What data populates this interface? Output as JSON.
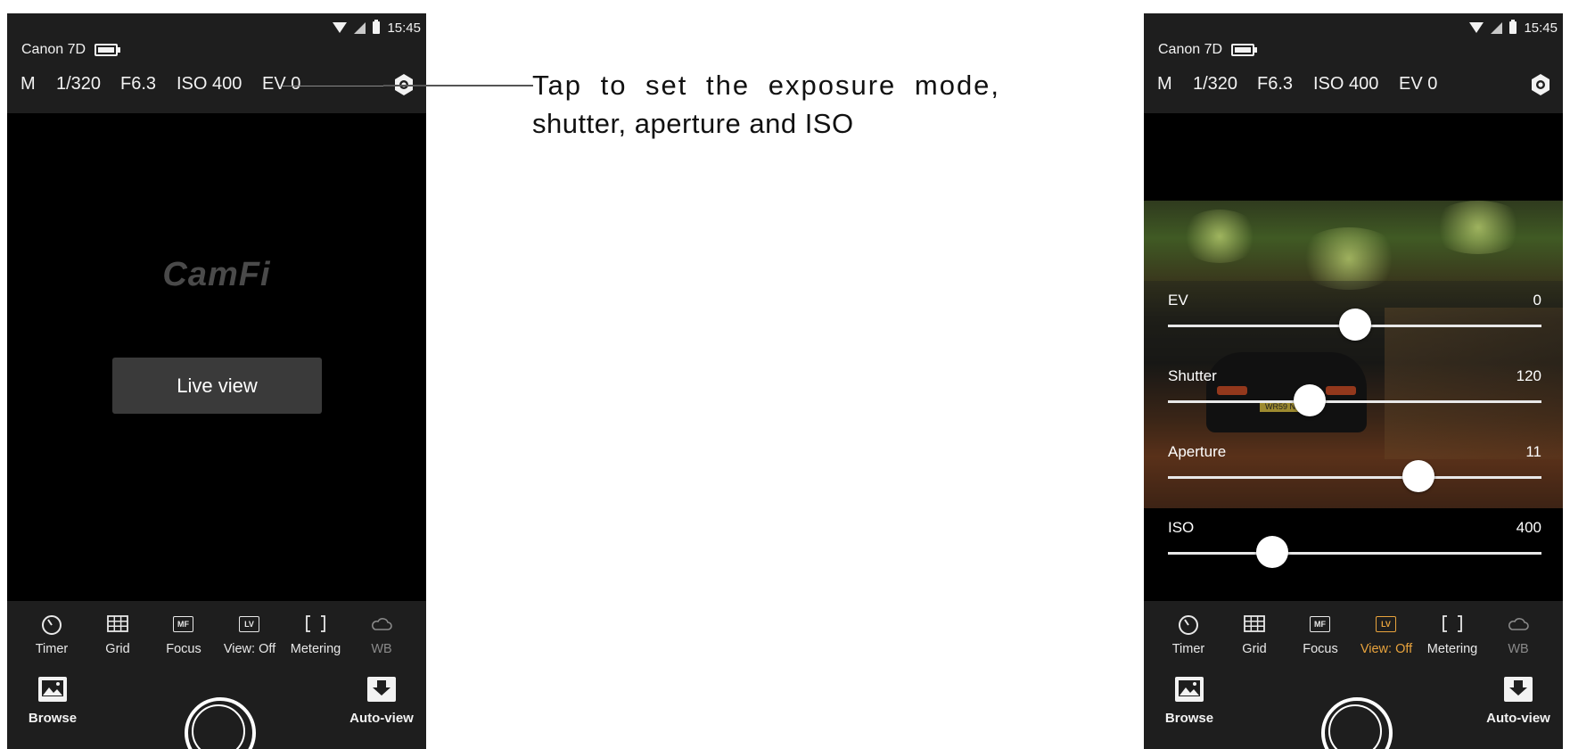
{
  "status_bar": {
    "time": "15:45"
  },
  "camera": {
    "name": "Canon 7D"
  },
  "exposure": {
    "mode": "M",
    "shutter": "1/320",
    "aperture": "F6.3",
    "iso": "ISO 400",
    "ev": "EV 0"
  },
  "left_screen": {
    "brand": "CamFi",
    "live_view_button": "Live view"
  },
  "toolbar": {
    "items": [
      {
        "label": "Timer",
        "icon": "timer-icon"
      },
      {
        "label": "Grid",
        "icon": "grid-icon"
      },
      {
        "label": "Focus",
        "icon": "mf-focus-icon"
      },
      {
        "label": "View: Off",
        "icon": "lv-view-icon"
      },
      {
        "label": "Metering",
        "icon": "metering-icon"
      },
      {
        "label": "WB",
        "icon": "cloud-wb-icon"
      }
    ],
    "browse": "Browse",
    "auto_view": "Auto-view"
  },
  "right_screen": {
    "sliders": [
      {
        "label": "EV",
        "value": "0",
        "position": 0.5
      },
      {
        "label": "Shutter",
        "value": "120",
        "position": 0.38
      },
      {
        "label": "Aperture",
        "value": "11",
        "position": 0.67
      },
      {
        "label": "ISO",
        "value": "400",
        "position": 0.28
      }
    ],
    "plate_text": "WR59 N-G"
  },
  "callout": {
    "line1": "Tap to set the exposure mode,",
    "line2": "shutter, aperture and ISO"
  },
  "colors": {
    "accent": "#e8a33d",
    "bar": "#1e1e1e",
    "button": "#3a3a3a"
  }
}
